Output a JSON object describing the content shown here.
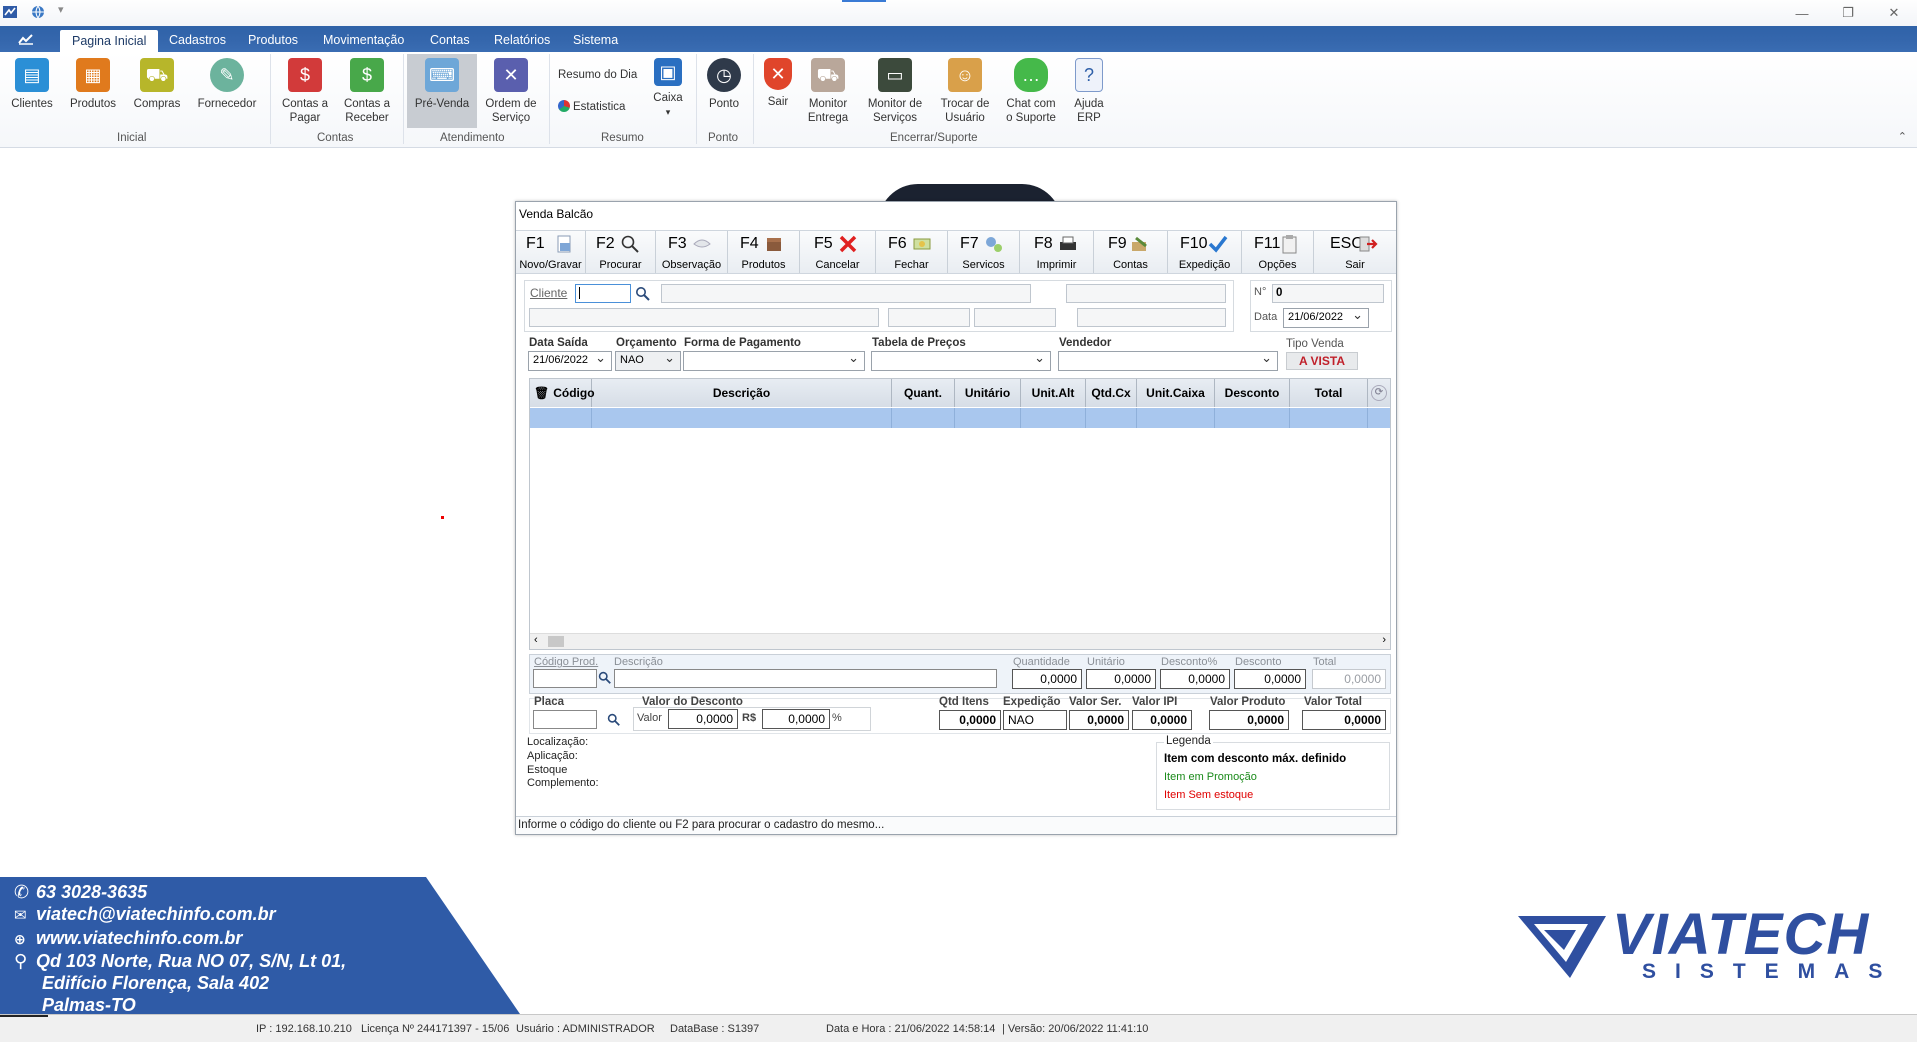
{
  "ribbon": {
    "tabs": [
      "Pagina Inicial",
      "Cadastros",
      "Produtos",
      "Movimentação",
      "Contas",
      "Relatórios",
      "Sistema"
    ],
    "groups": {
      "inicial": "Inicial",
      "contas": "Contas",
      "atendimento": "Atendimento",
      "resumo": "Resumo",
      "ponto": "Ponto",
      "encerrar": "Encerrar/Suporte"
    },
    "buttons": {
      "clientes": "Clientes",
      "produtos": "Produtos",
      "compras": "Compras",
      "fornecedor": "Fornecedor",
      "contas_pagar_1": "Contas a",
      "contas_pagar_2": "Pagar",
      "contas_receber_1": "Contas a",
      "contas_receber_2": "Receber",
      "pre_venda": "Pré-Venda",
      "ordem_1": "Ordem de",
      "ordem_2": "Serviço",
      "resumo_dia": "Resumo  do Dia",
      "estatistica": "Estatistica",
      "caixa": "Caixa",
      "ponto": "Ponto",
      "sair": "Sair",
      "monitor_entrega_1": "Monitor",
      "monitor_entrega_2": "Entrega",
      "monitor_servicos_1": "Monitor de",
      "monitor_servicos_2": "Serviços",
      "trocar_1": "Trocar de",
      "trocar_2": "Usuário",
      "chat_1": "Chat com",
      "chat_2": "o Suporte",
      "ajuda_1": "Ajuda",
      "ajuda_2": "ERP"
    }
  },
  "window": {
    "title": "Venda Balcão",
    "fkeys": [
      {
        "key": "F1",
        "label": "Novo/Gravar"
      },
      {
        "key": "F2",
        "label": "Procurar"
      },
      {
        "key": "F3",
        "label": "Observação"
      },
      {
        "key": "F4",
        "label": "Produtos"
      },
      {
        "key": "F5",
        "label": "Cancelar"
      },
      {
        "key": "F6",
        "label": "Fechar"
      },
      {
        "key": "F7",
        "label": "Servicos"
      },
      {
        "key": "F8",
        "label": "Imprimir"
      },
      {
        "key": "F9",
        "label": "Contas"
      },
      {
        "key": "F10",
        "label": "Expedição"
      },
      {
        "key": "F11",
        "label": "Opções"
      },
      {
        "key": "ESC",
        "label": "Sair"
      }
    ],
    "cliente_label": "Cliente",
    "numero_label": "N°",
    "numero_value": "0",
    "data_label": "Data",
    "data_value": "21/06/2022",
    "data_saida_label": "Data Saída",
    "data_saida_value": "21/06/2022",
    "orcamento_label": "Orçamento",
    "orcamento_value": "NAO",
    "forma_pagamento_label": "Forma de Pagamento",
    "tabela_precos_label": "Tabela de Preços",
    "vendedor_label": "Vendedor",
    "tipo_venda_label": "Tipo Venda",
    "tipo_venda_value": "A VISTA",
    "grid_headers": [
      "Código",
      "Descrição",
      "Quant.",
      "Unitário",
      "Unit.Alt",
      "Qtd.Cx",
      "Unit.Caixa",
      "Desconto",
      "Total"
    ],
    "item": {
      "codigo_label": "Código Prod.",
      "descricao_label": "Descrição",
      "quantidade_label": "Quantidade",
      "unitario_label": "Unitário",
      "desconto_pct_label": "Desconto%",
      "desconto_label": "Desconto",
      "total_label": "Total",
      "quantidade": "0,0000",
      "unitario": "0,0000",
      "desconto_pct": "0,0000",
      "desconto": "0,0000",
      "total": "0,0000"
    },
    "placa_label": "Placa",
    "valor_desconto_label": "Valor do Desconto",
    "valor_label": "Valor",
    "valor_value": "0,0000",
    "rs_label": "R$",
    "rs_value": "0,0000",
    "pct_symbol": "%",
    "totals": {
      "qtd_itens_label": "Qtd Itens",
      "qtd_itens": "0,0000",
      "expedicao_label": "Expedição",
      "expedicao": "NAO",
      "valor_ser_label": "Valor Ser.",
      "valor_ser": "0,0000",
      "valor_ipi_label": "Valor IPI",
      "valor_ipi": "0,0000",
      "valor_produto_label": "Valor Produto",
      "valor_produto": "0,0000",
      "valor_total_label": "Valor Total",
      "valor_total": "0,0000"
    },
    "info_labels": [
      "Localização:",
      "Aplicação:",
      "Estoque",
      "Complemento:"
    ],
    "legend": {
      "title": "Legenda",
      "item1": "Item com desconto máx. definido",
      "item2": "Item em Promoção",
      "item3": "Item Sem estoque",
      "colors": {
        "item1": "#000000",
        "item2": "#1a8a1a",
        "item3": "#e00000"
      }
    },
    "status_msg": "Informe o  código do cliente ou F2 para procurar o cadastro do mesmo..."
  },
  "contact": {
    "phone": "63 3028-3635",
    "email": "viatech@viatechinfo.com.br",
    "site": "www.viatechinfo.com.br",
    "addr1": "Qd 103 Norte, Rua NO 07, S/N, Lt 01,",
    "addr2": "Edifício Florença, Sala 402",
    "addr3": "Palmas-TO"
  },
  "logo": {
    "name": "VIATECH",
    "sub": "SISTEMAS"
  },
  "statusbar": {
    "ip": "IP : 192.168.10.210",
    "licenca": "Licença Nº 244171397 - 15/06",
    "usuario": "Usuário : ADMINISTRADOR",
    "database": "DataBase : S1397",
    "data_hora": "Data e Hora : 21/06/2022 14:58:14",
    "versao": "| Versão: 20/06/2022 11:41:10"
  },
  "colors": {
    "ribbon_blue": "#3567ad",
    "accent_red": "#c0202a",
    "brand_blue": "#2f4fa0",
    "panel_blue": "#2f5ba7"
  }
}
